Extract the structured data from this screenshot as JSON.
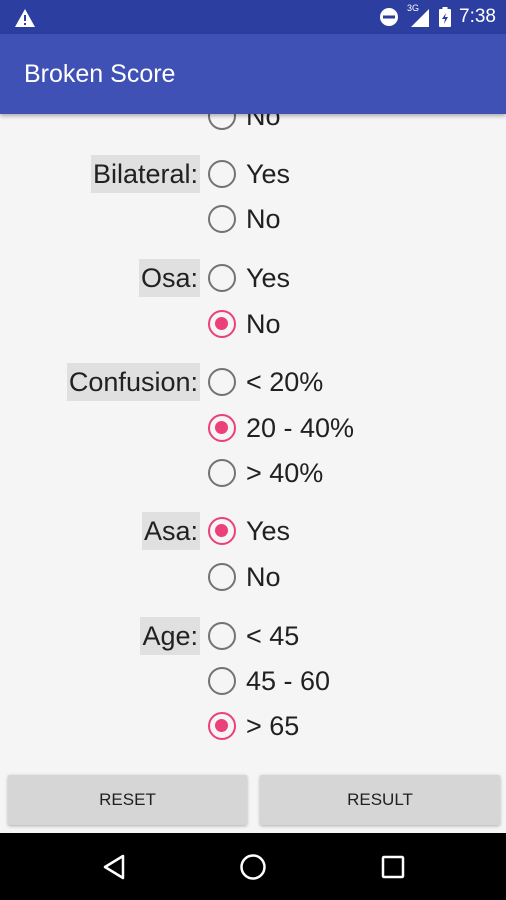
{
  "status_bar": {
    "time": "7:38",
    "network_label": "3G",
    "icons": [
      "warning-icon",
      "do-not-disturb-icon",
      "signal-icon",
      "battery-icon"
    ]
  },
  "app_bar": {
    "title": "Broken Score"
  },
  "top_partial_option": {
    "label": "No",
    "checked": false
  },
  "questions": [
    {
      "label": "Bilateral:",
      "options": [
        {
          "label": "Yes",
          "checked": false
        },
        {
          "label": "No",
          "checked": false
        }
      ]
    },
    {
      "label": "Osa:",
      "options": [
        {
          "label": "Yes",
          "checked": false
        },
        {
          "label": "No",
          "checked": true
        }
      ]
    },
    {
      "label": "Confusion:",
      "options": [
        {
          "label": "< 20%",
          "checked": false
        },
        {
          "label": "20 - 40%",
          "checked": true
        },
        {
          "label": "> 40%",
          "checked": false
        }
      ]
    },
    {
      "label": "Asa:",
      "options": [
        {
          "label": "Yes",
          "checked": true
        },
        {
          "label": "No",
          "checked": false
        }
      ]
    },
    {
      "label": "Age:",
      "options": [
        {
          "label": "< 45",
          "checked": false
        },
        {
          "label": "45 - 60",
          "checked": false
        },
        {
          "label": "> 65",
          "checked": true
        }
      ]
    }
  ],
  "buttons": {
    "reset": "RESET",
    "result": "RESULT"
  },
  "colors": {
    "status_bar": "#2c3ea0",
    "app_bar": "#3f51b5",
    "accent": "#ec407a",
    "radio_unchecked": "#737373"
  },
  "nav_bar": {
    "icons": [
      "back-icon",
      "home-icon",
      "recents-icon"
    ]
  }
}
